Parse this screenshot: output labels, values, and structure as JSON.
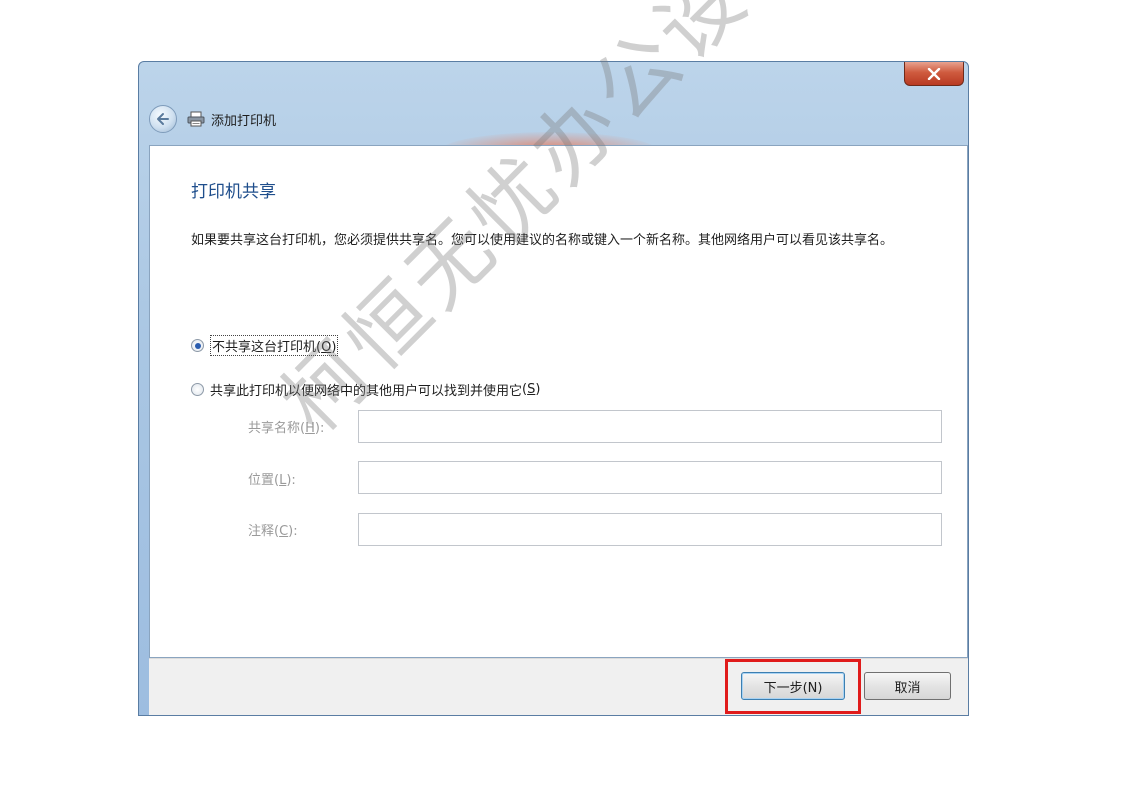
{
  "window": {
    "title": "添加打印机",
    "close_label": "x"
  },
  "page": {
    "heading": "打印机共享",
    "description": "如果要共享这台打印机，您必须提供共享名。您可以使用建议的名称或键入一个新名称。其他网络用户可以看见该共享名。"
  },
  "options": {
    "no_share": {
      "label": "不共享这台打印机",
      "accel": "O",
      "selected": true
    },
    "share": {
      "label": "共享此打印机以便网络中的其他用户可以找到并使用它",
      "accel": "S",
      "selected": false
    }
  },
  "fields": {
    "share_name": {
      "label": "共享名称",
      "accel": "H",
      "value": ""
    },
    "location": {
      "label": "位置",
      "accel": "L",
      "value": ""
    },
    "comment": {
      "label": "注释",
      "accel": "C",
      "value": ""
    }
  },
  "buttons": {
    "next": "下一步(N)",
    "cancel": "取消"
  },
  "watermark": "柯恒无忧办公设备",
  "colors": {
    "heading": "#1f4e8c",
    "highlight": "#e01b1b",
    "close_button": "#c4472d"
  },
  "icons": {
    "back": "back-arrow-icon",
    "printer": "printer-icon",
    "close": "close-icon"
  }
}
